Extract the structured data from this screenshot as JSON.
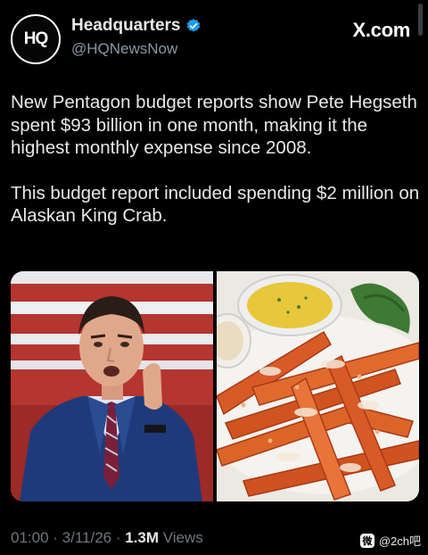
{
  "site": {
    "label": "X.com"
  },
  "author": {
    "display_name": "Headquarters",
    "handle": "@HQNewsNow",
    "avatar_text": "HQ",
    "verified": true
  },
  "post": {
    "paragraphs": [
      "New Pentagon budget reports show Pete Hegseth spent $93 billion in one month, making it the highest monthly expense since 2008.",
      "This budget report included spending $2 million on Alaskan King Crab."
    ]
  },
  "meta": {
    "timestamp": "01:00 · 3/11/26 · ",
    "views_count": "1.3M",
    "views_label": " Views"
  },
  "watermark": {
    "icon": "微",
    "text": "@2ch吧"
  },
  "colors": {
    "background": "#000000",
    "text": "#e7e9ea",
    "muted": "#71767b",
    "verified": "#1d9bf0"
  }
}
